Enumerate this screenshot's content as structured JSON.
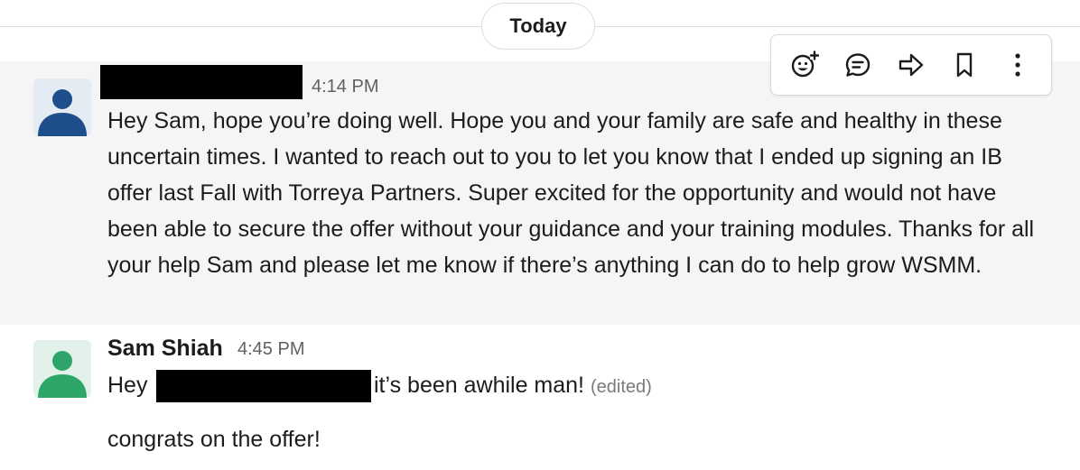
{
  "divider": {
    "label": "Today"
  },
  "messages": [
    {
      "sender": "",
      "time": "4:14 PM",
      "text": "Hey Sam, hope you’re doing well. Hope you and your family are safe and healthy in these uncertain times. I wanted to reach out to you to let you know that I ended up signing an IB offer last Fall with Torreya Partners. Super excited for the opportunity and would not have been able to secure the offer without your guidance and your training modules. Thanks for all your help Sam and please let me know if there’s anything I can do to help grow WSMM.",
      "avatar_color": "#1f4e8c",
      "avatar_bg": "#e4ebf3",
      "name_redacted": true
    },
    {
      "sender": "Sam Shiah",
      "time": "4:45 PM",
      "line1_start": "Hey",
      "line1_end": "it’s been awhile man!",
      "edited_label": "(edited)",
      "line2": "congrats on the offer!",
      "avatar_color": "#2ea66a",
      "avatar_bg": "#e2f1e9"
    }
  ],
  "toolbar": {
    "actions": [
      {
        "icon": "add-reaction-icon"
      },
      {
        "icon": "reply-in-thread-icon"
      },
      {
        "icon": "share-message-icon"
      },
      {
        "icon": "bookmark-icon"
      },
      {
        "icon": "more-actions-icon"
      }
    ]
  },
  "colors": {
    "hover_bg": "#f5f5f5",
    "divider": "#dddddd",
    "timestamp": "#616061",
    "text": "#1d1c1d"
  }
}
